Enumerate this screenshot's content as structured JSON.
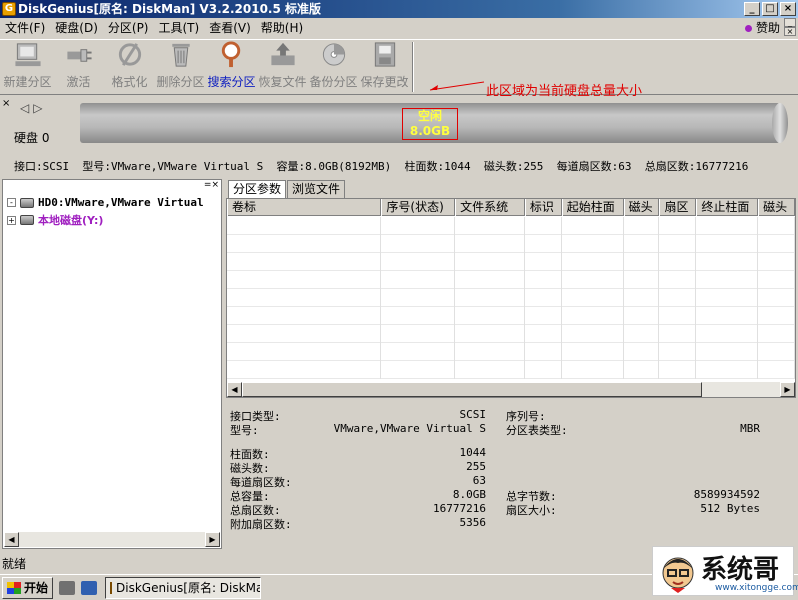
{
  "window": {
    "title": "DiskGenius[原名: DiskMan] V3.2.2010.5 标准版",
    "min": "_",
    "max": "□",
    "close": "×"
  },
  "menu": {
    "items": [
      "文件(F)",
      "硬盘(D)",
      "分区(P)",
      "工具(T)",
      "查看(V)",
      "帮助(H)"
    ],
    "donate": "赞助"
  },
  "toolbar": {
    "items": [
      {
        "label": "新建分区",
        "icon": "new-partition-icon"
      },
      {
        "label": "激活",
        "icon": "activate-icon"
      },
      {
        "label": "格式化",
        "icon": "format-icon"
      },
      {
        "label": "删除分区",
        "icon": "delete-partition-icon"
      },
      {
        "label": "搜索分区",
        "icon": "search-partition-icon"
      },
      {
        "label": "恢复文件",
        "icon": "recover-files-icon"
      },
      {
        "label": "备份分区",
        "icon": "backup-partition-icon"
      },
      {
        "label": "保存更改",
        "icon": "save-changes-icon"
      }
    ]
  },
  "annotation": "此区域为当前硬盘总量大小",
  "disk_panel": {
    "close": "×",
    "label": "硬盘 0",
    "free_label": "空闲",
    "free_size": "8.0GB",
    "info": "接口:SCSI  型号:VMware,VMware Virtual S  容量:8.0GB(8192MB)  柱面数:1044  磁头数:255  每道扇区数:63  总扇区数:16777216"
  },
  "tree": {
    "items": [
      {
        "label": "HD0:VMware,VMware Virtual",
        "color": "#000000"
      },
      {
        "label": "本地磁盘(Y:)",
        "color": "#a020c0"
      }
    ]
  },
  "tabs": [
    "分区参数",
    "浏览文件"
  ],
  "grid": {
    "columns": [
      "卷标",
      "序号(状态)",
      "文件系统",
      "标识",
      "起始柱面",
      "磁头",
      "扇区",
      "终止柱面",
      "磁头"
    ]
  },
  "info": {
    "interface_type_label": "接口类型:",
    "interface_type": "SCSI",
    "serial_label": "序列号:",
    "serial": "",
    "model_label": "型号:",
    "model": "VMware,VMware Virtual S",
    "pt_type_label": "分区表类型:",
    "pt_type": "MBR",
    "cylinders_label": "柱面数:",
    "cylinders": "1044",
    "heads_label": "磁头数:",
    "heads": "255",
    "spt_label": "每道扇区数:",
    "spt": "63",
    "capacity_label": "总容量:",
    "capacity": "8.0GB",
    "total_bytes_label": "总字节数:",
    "total_bytes": "8589934592",
    "total_sectors_label": "总扇区数:",
    "total_sectors": "16777216",
    "sector_size_label": "扇区大小:",
    "sector_size": "512 Bytes",
    "extra_sectors_label": "附加扇区数:",
    "extra_sectors": "5356"
  },
  "status": "就绪",
  "taskbar": {
    "start": "开始",
    "task": "DiskGenius[原名: DiskMa..."
  },
  "watermark": {
    "text": "系统哥",
    "url": "www.xitongge.com"
  }
}
